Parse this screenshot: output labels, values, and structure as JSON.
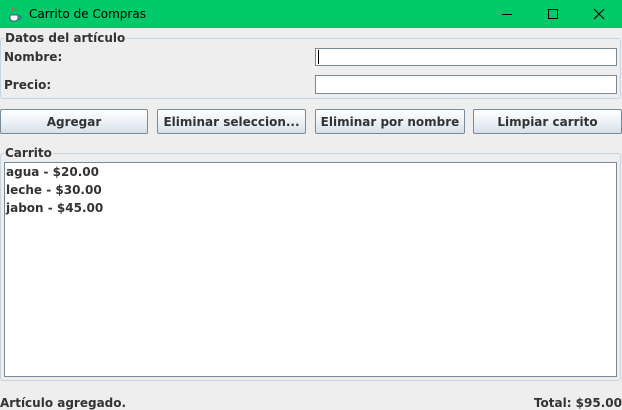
{
  "window": {
    "title": "Carrito de Compras",
    "titlebar_color": "#00c96a",
    "icon": "java-cup-icon",
    "controls": [
      "minimize-icon",
      "maximize-icon",
      "close-icon"
    ]
  },
  "datos": {
    "legend": "Datos del artículo",
    "nombre_label": "Nombre:",
    "nombre_value": "",
    "precio_label": "Precio:",
    "precio_value": ""
  },
  "buttons": {
    "agregar": "Agregar",
    "eliminar_seleccion": "Eliminar seleccion...",
    "eliminar_nombre": "Eliminar por nombre",
    "limpiar": "Limpiar carrito"
  },
  "carrito": {
    "legend": "Carrito",
    "items": [
      "agua - $20.00",
      "leche - $30.00",
      "jabon - $45.00"
    ]
  },
  "status": {
    "message": "Artículo agregado.",
    "total": "Total: $95.00"
  }
}
